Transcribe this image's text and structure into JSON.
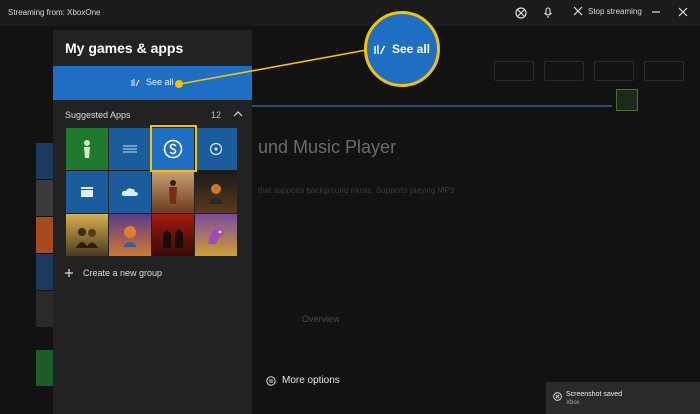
{
  "topbar": {
    "title": "Streaming from: XboxOne",
    "stop_label": "Stop streaming"
  },
  "background": {
    "app_title": "und Music Player",
    "desc_line1": "that supports background music. Supports playing MP3",
    "desc_line2": "",
    "tab_overview": "Overview",
    "tab_reviews": "",
    "more_options": "More options"
  },
  "panel": {
    "title": "My games & apps",
    "see_all": "See all",
    "section_title": "Suggested Apps",
    "section_count": "12",
    "create_group": "Create a new group"
  },
  "callout": {
    "label": "See all"
  },
  "toast": {
    "title": "Screenshot saved",
    "subtitle": "Xbox"
  },
  "tiles": [
    {
      "name": "avatar-app-tile",
      "color": "#1f7a2e"
    },
    {
      "name": "menu-app-tile",
      "color": "#1a5c9c"
    },
    {
      "name": "skype-app-tile",
      "color": "#1e6fc4"
    },
    {
      "name": "groove-app-tile",
      "color": "#1a5c9c"
    },
    {
      "name": "movies-app-tile",
      "color": "#1a5c9c"
    },
    {
      "name": "onedrive-app-tile",
      "color": "#1a5c9c"
    },
    {
      "name": "assassins-creed-tile",
      "color": "#a8643a"
    },
    {
      "name": "black-ops-tile",
      "color": "#3a2a20"
    },
    {
      "name": "borderlands-tile",
      "color": "#7a5a30"
    },
    {
      "name": "crash-bandicoot-tile",
      "color": "#8a3a5a"
    },
    {
      "name": "red-dead-redemption-tile",
      "color": "#8a1a10"
    },
    {
      "name": "spyro-tile",
      "color": "#6a3a8a"
    }
  ],
  "colors": {
    "accent_blue": "#1e6fc4",
    "highlight_yellow": "#f3c400"
  }
}
